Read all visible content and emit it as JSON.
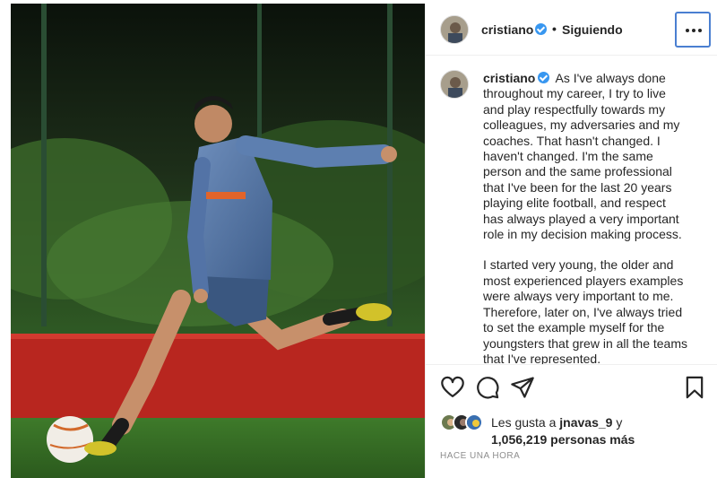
{
  "post": {
    "author": "cristiano",
    "separator": "•",
    "follow_status": "Siguiendo",
    "more_options_label": "Más opciones"
  },
  "caption": {
    "author": "cristiano",
    "paragraph1": "As I've always done throughout my career, I try to live and play respectfully towards my colleagues, my adversaries and my coaches. That hasn't changed. I haven't changed. I'm the same person and the same professional that I've been for the last 20 years playing elite football, and respect has always played a very important role in my decision making process.",
    "paragraph2": "I started very young, the older and most experienced players examples were always very important to me. Therefore, later on, I've always tried to set the example myself for the youngsters that grew in all the teams that I've represented."
  },
  "actions": {
    "like_icon": "heart-icon",
    "comment_icon": "comment-icon",
    "share_icon": "paper-plane-icon",
    "save_icon": "bookmark-icon"
  },
  "likes": {
    "prefix": "Les gusta a",
    "first_liker": "jnavas_9",
    "conjunction": "y",
    "others": "1,056,219 personas más"
  },
  "timestamp": "HACE UNA HORA",
  "colors": {
    "verified_badge": "#3897f0",
    "text": "#262626",
    "muted": "#8e8e8e",
    "focus_ring": "#4a7fd1"
  }
}
